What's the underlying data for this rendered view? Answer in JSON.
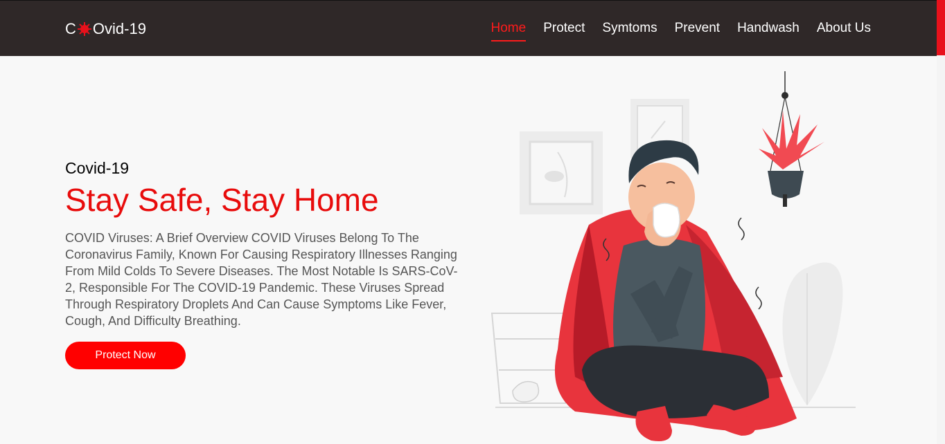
{
  "nav": {
    "logo_prefix": "C",
    "logo_suffix": "Ovid-19",
    "links": [
      {
        "label": "Home",
        "active": true
      },
      {
        "label": "Protect"
      },
      {
        "label": "Symtoms"
      },
      {
        "label": "Prevent"
      },
      {
        "label": "Handwash"
      },
      {
        "label": "About Us"
      }
    ]
  },
  "hero": {
    "subtitle": "Covid-19",
    "title": "Stay Safe, Stay Home",
    "description": "COVID Viruses: A Brief Overview COVID Viruses Belong To The Coronavirus Family, Known For Causing Respiratory Illnesses Ranging From Mild Colds To Severe Diseases. The Most Notable Is SARS-CoV-2, Responsible For The COVID-19 Pandemic. These Viruses Spread Through Respiratory Droplets And Can Cause Symptoms Like Fever, Cough, And Difficulty Breathing.",
    "cta_label": "Protect Now"
  },
  "colors": {
    "accent": "#e80c0c",
    "navbar": "#2f2828",
    "background": "#f8f8f8"
  },
  "icons": {
    "logo_icon": "virus-icon",
    "illustration": "sick-person-illustration"
  }
}
